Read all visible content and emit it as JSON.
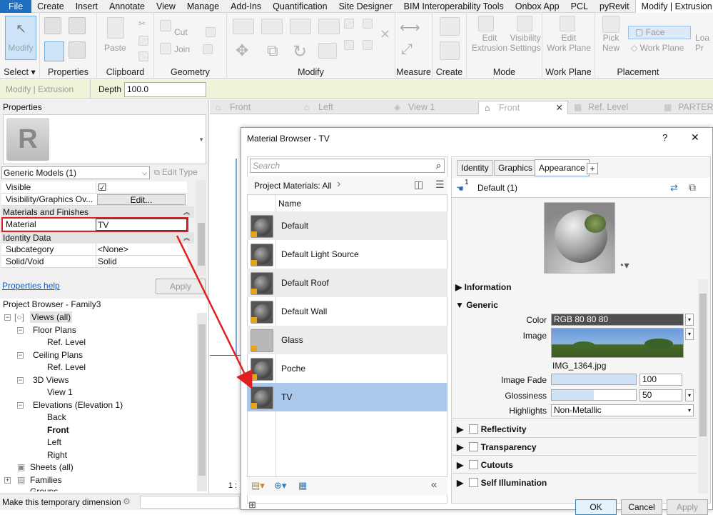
{
  "menubar": {
    "items": [
      "File",
      "Create",
      "Insert",
      "Annotate",
      "View",
      "Manage",
      "Add-Ins",
      "Quantification",
      "Site Designer",
      "BIM Interoperability Tools",
      "Onbox App",
      "PCL",
      "pyRevit",
      "Modify | Extrusion"
    ]
  },
  "ribbon": {
    "modify": "Modify",
    "select_label": "Select ▾",
    "properties_label": "Properties",
    "paste": "Paste",
    "clipboard_label": "Clipboard",
    "cut": "Cut",
    "join": "Join",
    "geometry_label": "Geometry",
    "modify_label": "Modify",
    "measure_label": "Measure",
    "create_label": "Create",
    "edit_extrusion": "Edit\nExtrusion",
    "visibility_settings": "Visibility\nSettings",
    "mode_label": "Mode",
    "edit_work_plane": "Edit\nWork Plane",
    "work_plane_label": "Work Plane",
    "pick_new": "Pick\nNew",
    "face": "Face",
    "work_plane": "Work Plane",
    "placement_label": "Placement",
    "load": "Loa\nPr"
  },
  "optbar": {
    "context": "Modify | Extrusion",
    "depth_label": "Depth",
    "depth_value": "100.0"
  },
  "properties": {
    "title": "Properties",
    "type_selector": "Generic Models (1)",
    "edit_type": "Edit Type",
    "rows": [
      {
        "label": "Visible",
        "value": "☑"
      },
      {
        "label": "Visibility/Graphics Ov...",
        "value": "Edit..."
      }
    ],
    "section_materials": "Materials and Finishes",
    "material_label": "Material",
    "material_value": "TV",
    "section_identity": "Identity Data",
    "subcategory_label": "Subcategory",
    "subcategory_value": "<None>",
    "solidvoid_label": "Solid/Void",
    "solidvoid_value": "Solid",
    "help": "Properties help",
    "apply": "Apply"
  },
  "project_browser": {
    "title": "Project Browser - Family3",
    "items": [
      "Views (all)",
      "Floor Plans",
      "Ref. Level",
      "Ceiling Plans",
      "Ref. Level",
      "3D Views",
      "View 1",
      "Elevations (Elevation 1)",
      "Back",
      "Front",
      "Left",
      "Right",
      "Sheets (all)",
      "Families",
      "Groups"
    ]
  },
  "status": {
    "text": "Make this temporary dimension"
  },
  "view_tabs": [
    "Front",
    "Left",
    "View 1",
    "Front",
    "Ref. Level",
    "PARTER"
  ],
  "view_close": "✕",
  "scale_text": "1 :",
  "dialog": {
    "title": "Material Browser - TV",
    "help": "?",
    "close": "✕",
    "search_placeholder": "Search",
    "filter": "Project Materials: All",
    "col_name": "Name",
    "materials": [
      "Default",
      "Default Light Source",
      "Default Roof",
      "Default Wall",
      "Glass",
      "Poche",
      "TV"
    ],
    "tabs": [
      "Identity",
      "Graphics",
      "Appearance",
      "+"
    ],
    "asset_count": "1",
    "asset_name": "Default (1)",
    "sections": {
      "information": "Information",
      "generic": "Generic",
      "reflectivity": "Reflectivity",
      "transparency": "Transparency",
      "cutouts": "Cutouts",
      "self_illumination": "Self Illumination"
    },
    "color_label": "Color",
    "color_value": "RGB 80 80 80",
    "image_label": "Image",
    "image_file": "IMG_1364.jpg",
    "image_fade_label": "Image Fade",
    "image_fade_value": "100",
    "glossiness_label": "Glossiness",
    "glossiness_value": "50",
    "highlights_label": "Highlights",
    "highlights_value": "Non-Metallic",
    "ok": "OK",
    "cancel": "Cancel",
    "apply": "Apply",
    "image_fade_fraction": 1.0,
    "glossiness_fraction": 0.5
  },
  "colors": {
    "accent": "#1e6fbf",
    "selection": "#aac8ea",
    "highlight": "#e02020",
    "optbar": "#eef4d8"
  }
}
